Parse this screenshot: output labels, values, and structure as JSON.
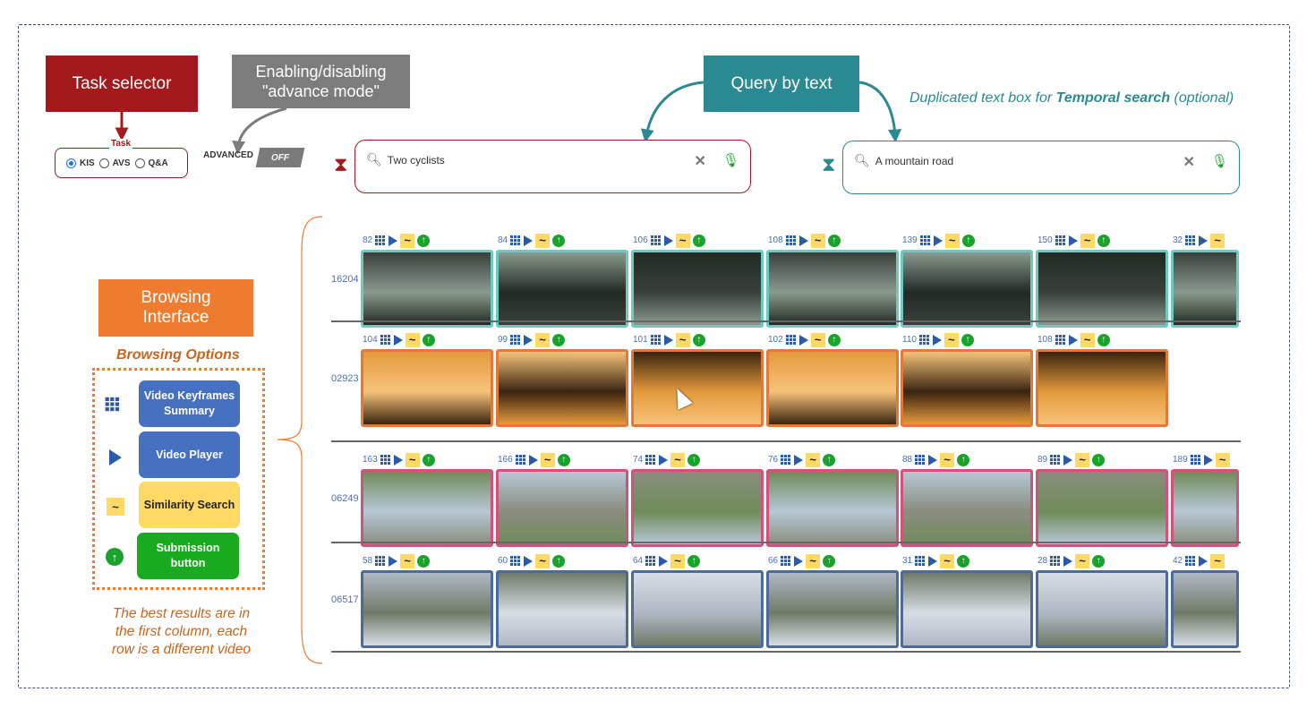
{
  "callouts": {
    "task_selector": "Task selector",
    "advance_mode_line1": "Enabling/disabling",
    "advance_mode_line2": "\"advance mode\"",
    "query_by_text": "Query by text",
    "browsing_interface_line1": "Browsing",
    "browsing_interface_line2": "Interface",
    "temporal_note_prefix": "Duplicated text box for ",
    "temporal_note_bold": "Temporal search",
    "temporal_note_suffix": " (optional)"
  },
  "task": {
    "title": "Task",
    "options": [
      "KIS",
      "AVS",
      "Q&A"
    ],
    "selected": "KIS"
  },
  "advanced": {
    "label": "ADVANCED",
    "toggle": "OFF"
  },
  "search": {
    "primary_value": "Two cyclists",
    "temporal_value": "A mountain road"
  },
  "browsing_options": {
    "title": "Browsing Options",
    "summary_line1": "Video Keyframes",
    "summary_line2": "Summary",
    "player": "Video Player",
    "similarity": "Similarity Search",
    "submit_line1": "Submission",
    "submit_line2": "button"
  },
  "note": {
    "line1": "The best results are in",
    "line2": "the first column, each",
    "line3": "row is a different video"
  },
  "results": [
    {
      "video_id": "16204",
      "border": "#6ec9c4",
      "frames": [
        "82",
        "84",
        "106",
        "108",
        "139",
        "150",
        "32"
      ]
    },
    {
      "video_id": "02923",
      "border": "#e2783a",
      "frames": [
        "104",
        "99",
        "101",
        "102",
        "110",
        "108"
      ]
    },
    {
      "video_id": "06249",
      "border": "#d2527a",
      "frames": [
        "163",
        "166",
        "74",
        "76",
        "88",
        "89",
        "189"
      ]
    },
    {
      "video_id": "06517",
      "border": "#4c6a9a",
      "frames": [
        "58",
        "60",
        "64",
        "66",
        "31",
        "28",
        "42"
      ]
    }
  ],
  "icons": {
    "grid": "keyframes-grid-icon",
    "play": "play-icon",
    "similarity": "similarity-tilde-icon",
    "submit": "upload-arrow-icon",
    "search": "magnifier-icon",
    "clear": "clear-x-icon",
    "mic": "microphone-icon",
    "hourglass": "hourglass-icon"
  }
}
